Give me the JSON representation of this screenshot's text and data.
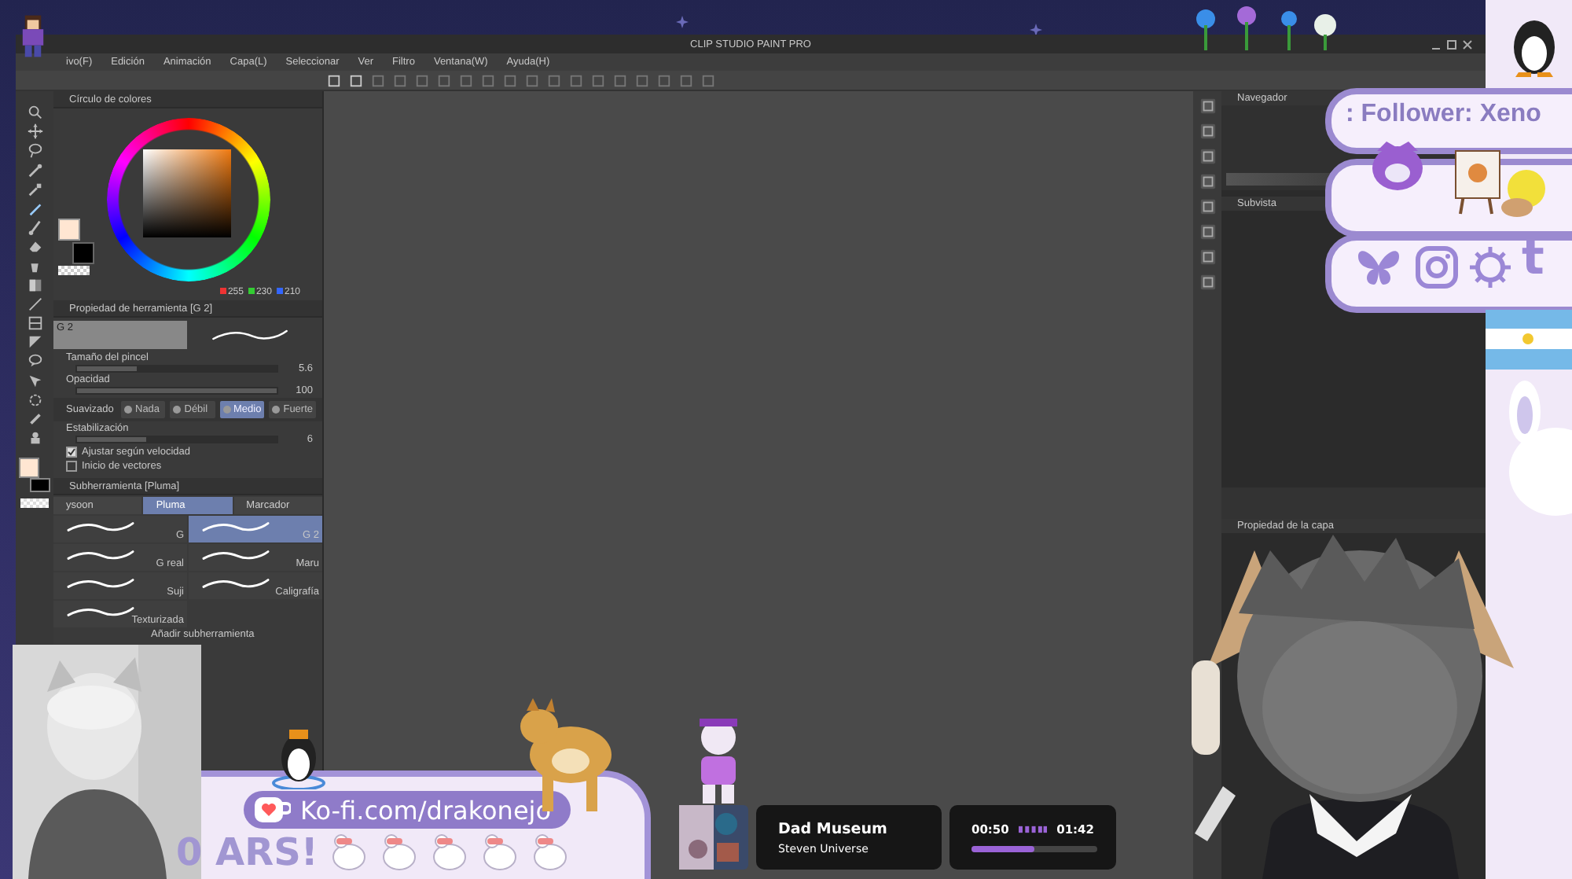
{
  "app": {
    "title": "CLIP STUDIO PAINT PRO",
    "menu": [
      "ivo(F)",
      "Edición",
      "Animación",
      "Capa(L)",
      "Seleccionar",
      "Ver",
      "Filtro",
      "Ventana(W)",
      "Ayuda(H)"
    ]
  },
  "color_panel": {
    "title": "Círculo de colores",
    "rgb": [
      "255",
      "230",
      "210"
    ]
  },
  "tool_property": {
    "title": "Propiedad de herramienta [G 2]",
    "preset": "G 2",
    "sliders": [
      {
        "label": "Tamaño del pincel",
        "value": "5.6",
        "level": 0.3
      },
      {
        "label": "Opacidad",
        "value": "100",
        "level": 1
      }
    ],
    "smoothing": {
      "label": "Suavizado",
      "options": [
        {
          "label": "Nada",
          "selected": false
        },
        {
          "label": "Débil",
          "selected": false
        },
        {
          "label": "Medio",
          "selected": true
        },
        {
          "label": "Fuerte",
          "selected": false
        }
      ]
    },
    "stabilization": {
      "label": "Estabilización",
      "value": "6",
      "level": 0.35
    },
    "checkboxes": [
      {
        "label": "Ajustar según velocidad",
        "checked": true
      },
      {
        "label": "Inicio de vectores",
        "checked": false
      }
    ]
  },
  "sub_tool": {
    "title": "Subherramienta [Pluma]",
    "tabs": [
      {
        "label": "ysoon",
        "selected": false
      },
      {
        "label": "Pluma",
        "selected": true
      },
      {
        "label": "Marcador",
        "selected": false
      }
    ],
    "brushes": [
      {
        "label": "G",
        "selected": false
      },
      {
        "label": "G 2",
        "selected": true
      },
      {
        "label": "G real",
        "selected": false
      },
      {
        "label": "Maru",
        "selected": false
      },
      {
        "label": "Suji",
        "selected": false
      },
      {
        "label": "Caligrafía",
        "selected": false
      },
      {
        "label": "Texturizada",
        "selected": false
      }
    ],
    "add_label": "Añadir subherramienta"
  },
  "right_panels": {
    "navigator": "Navegador",
    "subview": "Subvista",
    "layer_property": "Propiedad de la capa"
  },
  "overlay": {
    "ticker": ": Follower: Xeno",
    "social_glyph": "t",
    "kofi": "Ko-fi.com/drakonejo",
    "goal": "0 ARS!",
    "now_playing": {
      "title": "Dad Museum",
      "artist": "Steven Universe",
      "elapsed": "00:50",
      "total": "01:42",
      "level": 0.5
    }
  }
}
